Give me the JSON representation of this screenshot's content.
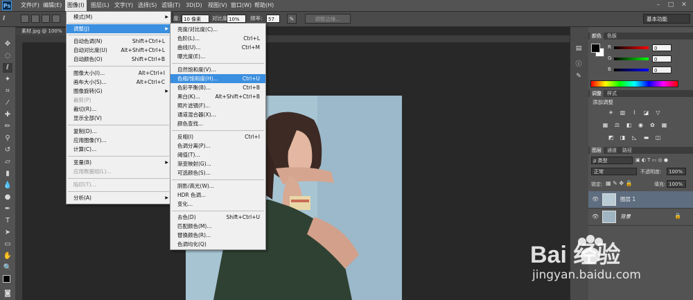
{
  "menubar": {
    "logo": "Ps",
    "items": [
      "文件(F)",
      "编辑(E)",
      "图像(I)",
      "图层(L)",
      "文字(Y)",
      "选择(S)",
      "滤镜(T)",
      "3D(D)",
      "视图(V)",
      "窗口(W)",
      "帮助(H)"
    ]
  },
  "options": {
    "feather_value": "10 像素",
    "feather_label_suffix": "度:",
    "contrast_label": "对比度:",
    "contrast_value": "10%",
    "freq_label": "频率:",
    "freq_value": "57",
    "refine_edge": "调整边缘...",
    "workspace": "基本功能"
  },
  "document": {
    "tab_title": "素材.jpg @ 100%"
  },
  "image_menu": {
    "items": [
      {
        "label": "模式(M)",
        "shortcut": "",
        "arrow": true,
        "disabled": false
      },
      {
        "label": "调整(J)",
        "shortcut": "",
        "arrow": true,
        "disabled": false,
        "highlight": true
      },
      {
        "label": "自动色调(N)",
        "shortcut": "Shift+Ctrl+L",
        "arrow": false,
        "disabled": false
      },
      {
        "label": "自动对比度(U)",
        "shortcut": "Alt+Shift+Ctrl+L",
        "arrow": false,
        "disabled": false
      },
      {
        "label": "自动颜色(O)",
        "shortcut": "Shift+Ctrl+B",
        "arrow": false,
        "disabled": false
      },
      {
        "label": "图像大小(I)...",
        "shortcut": "Alt+Ctrl+I",
        "arrow": false,
        "disabled": false
      },
      {
        "label": "画布大小(S)...",
        "shortcut": "Alt+Ctrl+C",
        "arrow": false,
        "disabled": false
      },
      {
        "label": "图像旋转(G)",
        "shortcut": "",
        "arrow": true,
        "disabled": false
      },
      {
        "label": "裁剪(P)",
        "shortcut": "",
        "arrow": false,
        "disabled": true
      },
      {
        "label": "裁切(R)...",
        "shortcut": "",
        "arrow": false,
        "disabled": false
      },
      {
        "label": "显示全部(V)",
        "shortcut": "",
        "arrow": false,
        "disabled": false
      },
      {
        "label": "复制(D)...",
        "shortcut": "",
        "arrow": false,
        "disabled": false
      },
      {
        "label": "应用图像(Y)...",
        "shortcut": "",
        "arrow": false,
        "disabled": false
      },
      {
        "label": "计算(C)...",
        "shortcut": "",
        "arrow": false,
        "disabled": false
      },
      {
        "label": "变量(B)",
        "shortcut": "",
        "arrow": true,
        "disabled": false
      },
      {
        "label": "应用数据组(L)...",
        "shortcut": "",
        "arrow": false,
        "disabled": true
      },
      {
        "label": "陷印(T)...",
        "shortcut": "",
        "arrow": false,
        "disabled": true
      },
      {
        "label": "分析(A)",
        "shortcut": "",
        "arrow": true,
        "disabled": false
      }
    ]
  },
  "adjust_menu": {
    "items": [
      {
        "label": "亮度/对比度(C)...",
        "shortcut": ""
      },
      {
        "label": "色阶(L)...",
        "shortcut": "Ctrl+L"
      },
      {
        "label": "曲线(U)...",
        "shortcut": "Ctrl+M"
      },
      {
        "label": "曝光度(E)...",
        "shortcut": ""
      },
      {
        "label": "自然饱和度(V)...",
        "shortcut": ""
      },
      {
        "label": "色相/饱和度(H)...",
        "shortcut": "Ctrl+U",
        "highlight": true
      },
      {
        "label": "色彩平衡(B)...",
        "shortcut": "Ctrl+B"
      },
      {
        "label": "黑白(K)...",
        "shortcut": "Alt+Shift+Ctrl+B"
      },
      {
        "label": "照片滤镜(F)...",
        "shortcut": ""
      },
      {
        "label": "通道混合器(X)...",
        "shortcut": ""
      },
      {
        "label": "颜色查找...",
        "shortcut": ""
      },
      {
        "label": "反相(I)",
        "shortcut": "Ctrl+I"
      },
      {
        "label": "色调分离(P)...",
        "shortcut": ""
      },
      {
        "label": "阈值(T)...",
        "shortcut": ""
      },
      {
        "label": "渐变映射(G)...",
        "shortcut": ""
      },
      {
        "label": "可选颜色(S)...",
        "shortcut": ""
      },
      {
        "label": "阴影/高光(W)...",
        "shortcut": ""
      },
      {
        "label": "HDR 色调...",
        "shortcut": ""
      },
      {
        "label": "变化...",
        "shortcut": ""
      },
      {
        "label": "去色(D)",
        "shortcut": "Shift+Ctrl+U"
      },
      {
        "label": "匹配颜色(M)...",
        "shortcut": ""
      },
      {
        "label": "替换颜色(R)...",
        "shortcut": ""
      },
      {
        "label": "色调均化(Q)",
        "shortcut": ""
      }
    ]
  },
  "color_panel": {
    "tabs": [
      "颜色",
      "色板"
    ],
    "channels": [
      {
        "name": "R",
        "value": "0"
      },
      {
        "name": "G",
        "value": "0"
      },
      {
        "name": "B",
        "value": "0"
      }
    ]
  },
  "adjustments_panel": {
    "tabs": [
      "调整",
      "样式"
    ],
    "title": "添加调整"
  },
  "layers_panel": {
    "tabs": [
      "图层",
      "通道",
      "路径"
    ],
    "kind_filter": "ρ 类型",
    "blend_mode": "正常",
    "opacity_label": "不透明度:",
    "opacity_value": "100%",
    "lock_label": "锁定:",
    "fill_label": "填充:",
    "fill_value": "100%",
    "layers": [
      {
        "name": "图层 1",
        "selected": true
      },
      {
        "name": "背景",
        "selected": false
      }
    ]
  },
  "watermark": {
    "logo_text": "Bai  经验",
    "url": "jingyan.baidu.com"
  },
  "colors": {
    "highlight": "#3b8fe0",
    "ui_dark": "#282828",
    "ui_mid": "#535353"
  }
}
